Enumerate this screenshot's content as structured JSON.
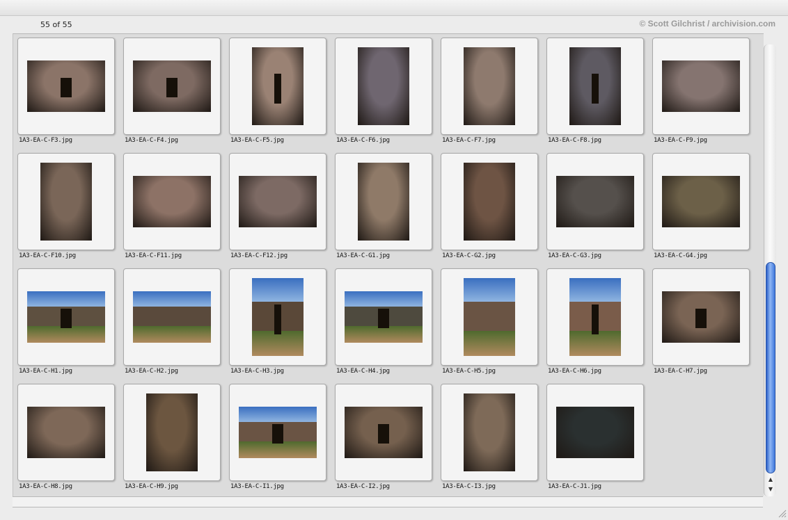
{
  "header": {
    "count": "55 of 55",
    "credit": "© Scott Gilchrist / archivision.com"
  },
  "images": [
    {
      "name": "1A3-EA-C-F3.jpg",
      "orientation": "landscape",
      "scene": "interior",
      "tone": "#8b7468",
      "door": true
    },
    {
      "name": "1A3-EA-C-F4.jpg",
      "orientation": "landscape",
      "scene": "interior",
      "tone": "#7e6a62",
      "door": true
    },
    {
      "name": "1A3-EA-C-F5.jpg",
      "orientation": "portrait",
      "scene": "interior",
      "tone": "#9a8274",
      "door": true
    },
    {
      "name": "1A3-EA-C-F6.jpg",
      "orientation": "portrait",
      "scene": "interior",
      "tone": "#6f6670",
      "door": false
    },
    {
      "name": "1A3-EA-C-F7.jpg",
      "orientation": "portrait",
      "scene": "interior",
      "tone": "#8e7a6e",
      "door": false
    },
    {
      "name": "1A3-EA-C-F8.jpg",
      "orientation": "portrait",
      "scene": "interior",
      "tone": "#5e5a62",
      "door": true
    },
    {
      "name": "1A3-EA-C-F9.jpg",
      "orientation": "landscape",
      "scene": "interior",
      "tone": "#857470",
      "door": false
    },
    {
      "name": "1A3-EA-C-F10.jpg",
      "orientation": "portrait",
      "scene": "interior",
      "tone": "#7a6658",
      "door": false
    },
    {
      "name": "1A3-EA-C-F11.jpg",
      "orientation": "landscape",
      "scene": "interior",
      "tone": "#8d7266",
      "door": false
    },
    {
      "name": "1A3-EA-C-F12.jpg",
      "orientation": "landscape",
      "scene": "interior",
      "tone": "#7d6a64",
      "door": false
    },
    {
      "name": "1A3-EA-C-G1.jpg",
      "orientation": "portrait",
      "scene": "interior",
      "tone": "#8f7a68",
      "door": false
    },
    {
      "name": "1A3-EA-C-G2.jpg",
      "orientation": "portrait",
      "scene": "interior",
      "tone": "#6e5444",
      "door": false
    },
    {
      "name": "1A3-EA-C-G3.jpg",
      "orientation": "landscape",
      "scene": "interior",
      "tone": "#55504c",
      "door": false
    },
    {
      "name": "1A3-EA-C-G4.jpg",
      "orientation": "landscape",
      "scene": "interior",
      "tone": "#6c6048",
      "door": false
    },
    {
      "name": "1A3-EA-C-H1.jpg",
      "orientation": "landscape",
      "scene": "exterior",
      "tone": "#5e5040",
      "door": true
    },
    {
      "name": "1A3-EA-C-H2.jpg",
      "orientation": "landscape",
      "scene": "exterior",
      "tone": "#5a4a3c",
      "door": false
    },
    {
      "name": "1A3-EA-C-H3.jpg",
      "orientation": "portrait",
      "scene": "exterior",
      "tone": "#5a4838",
      "door": true
    },
    {
      "name": "1A3-EA-C-H4.jpg",
      "orientation": "landscape",
      "scene": "exterior",
      "tone": "#4e4a3e",
      "door": true
    },
    {
      "name": "1A3-EA-C-H5.jpg",
      "orientation": "portrait",
      "scene": "exterior",
      "tone": "#6a5444",
      "door": false
    },
    {
      "name": "1A3-EA-C-H6.jpg",
      "orientation": "portrait",
      "scene": "exterior",
      "tone": "#7a5c4a",
      "door": true
    },
    {
      "name": "1A3-EA-C-H7.jpg",
      "orientation": "landscape",
      "scene": "interior",
      "tone": "#7a6454",
      "door": true
    },
    {
      "name": "1A3-EA-C-H8.jpg",
      "orientation": "landscape",
      "scene": "interior",
      "tone": "#7e6858",
      "door": false
    },
    {
      "name": "1A3-EA-C-H9.jpg",
      "orientation": "portrait",
      "scene": "interior",
      "tone": "#6c5640",
      "door": false
    },
    {
      "name": "1A3-EA-C-I1.jpg",
      "orientation": "landscape",
      "scene": "exterior",
      "tone": "#6a5444",
      "door": true
    },
    {
      "name": "1A3-EA-C-I2.jpg",
      "orientation": "landscape",
      "scene": "interior",
      "tone": "#75604e",
      "door": true
    },
    {
      "name": "1A3-EA-C-I3.jpg",
      "orientation": "portrait",
      "scene": "interior",
      "tone": "#7e6a58",
      "door": false
    },
    {
      "name": "1A3-EA-C-J1.jpg",
      "orientation": "landscape",
      "scene": "interior",
      "tone": "#2a3030",
      "door": false
    }
  ],
  "colors": {
    "accent": "#3f78dc",
    "pane": "#dcdcdc"
  }
}
